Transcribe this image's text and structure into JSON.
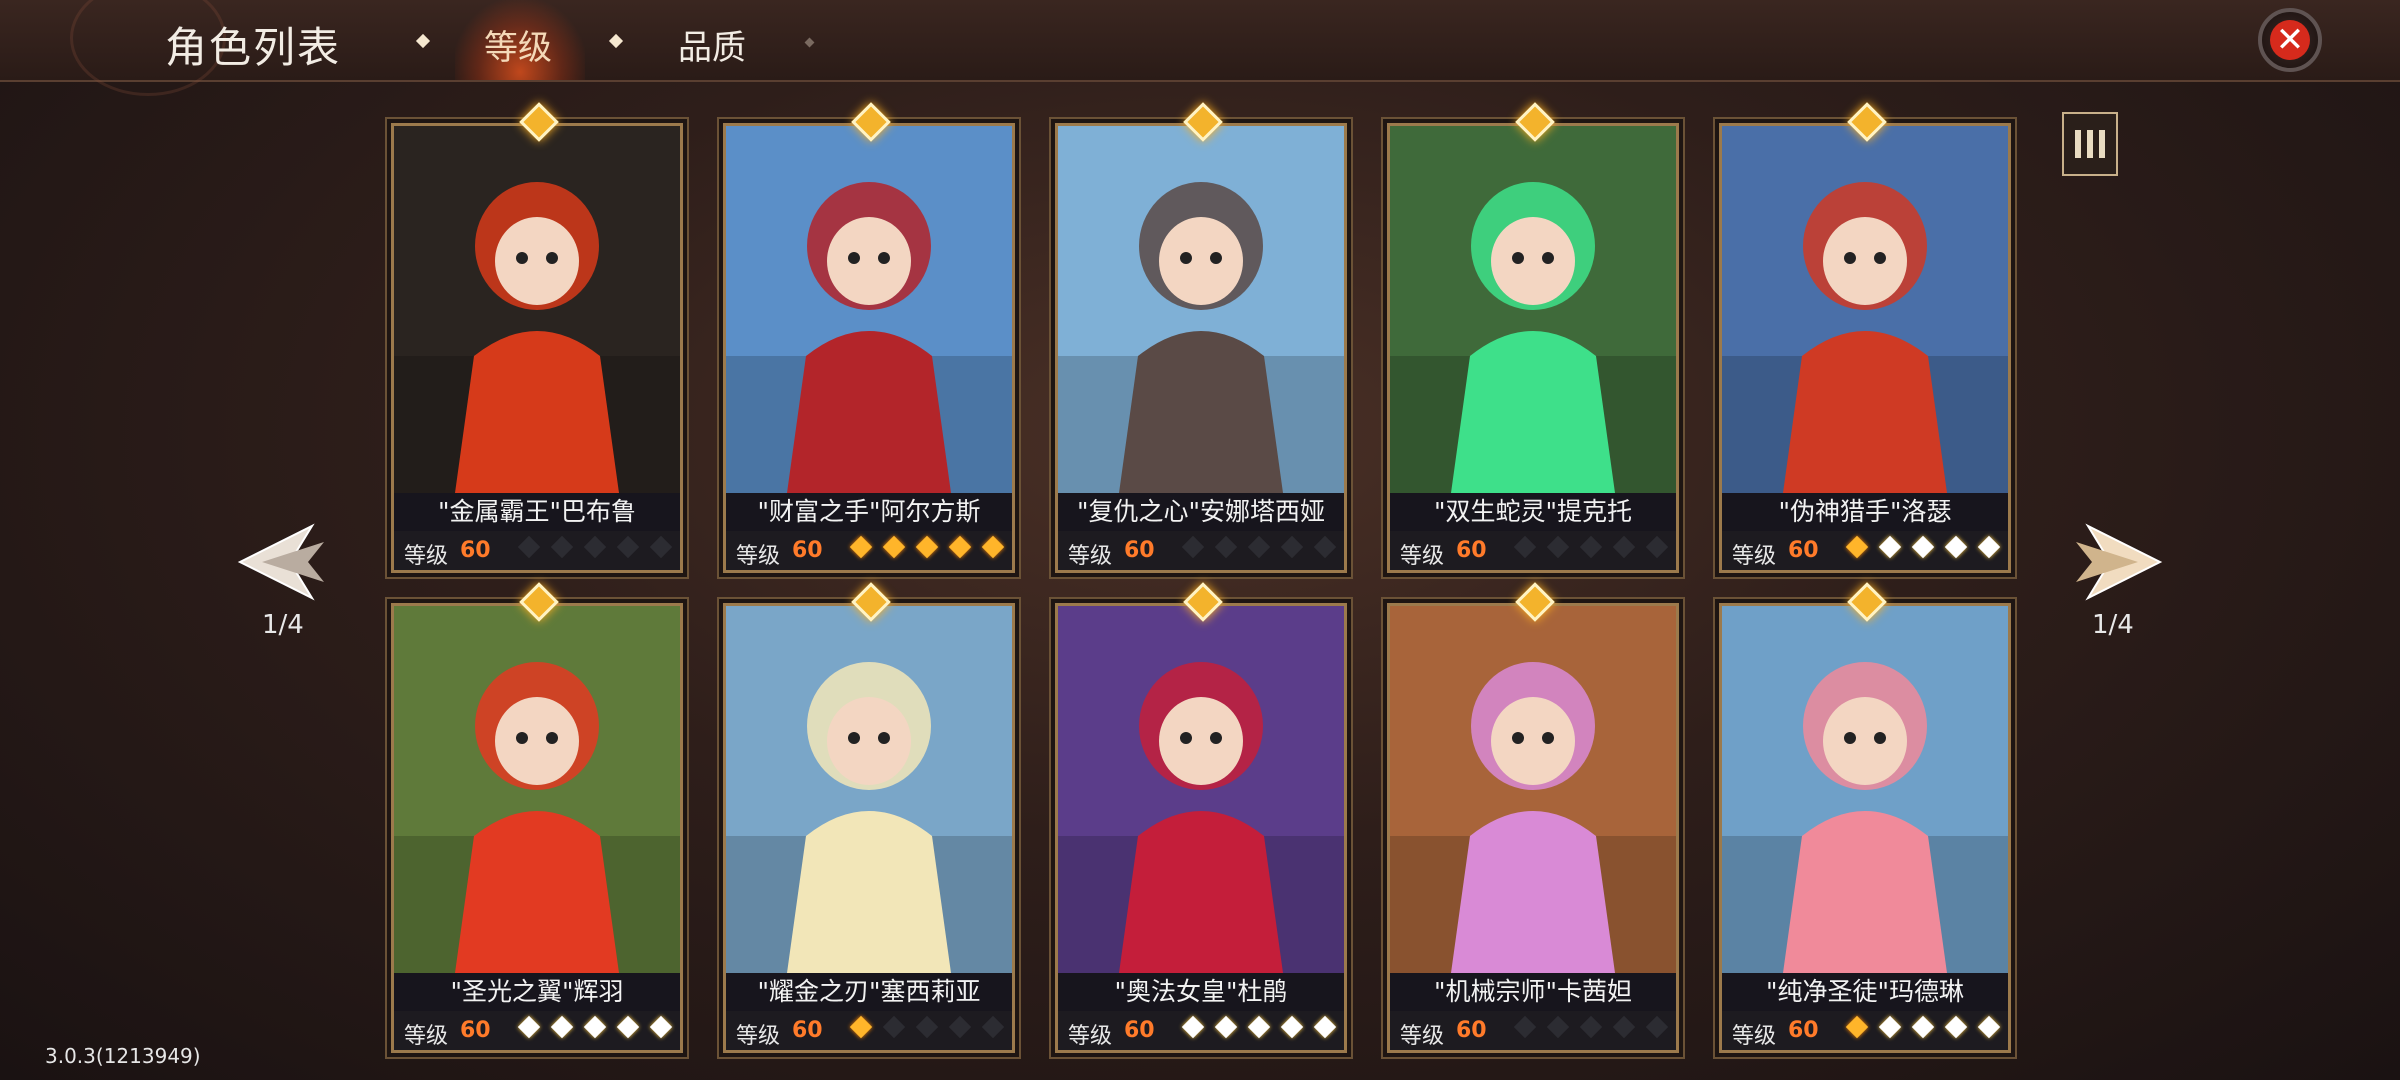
{
  "header": {
    "title": "角色列表",
    "tabs": [
      {
        "label": "等级",
        "active": true
      },
      {
        "label": "品质",
        "active": false
      }
    ]
  },
  "pager": {
    "left": "1/4",
    "right": "1/4"
  },
  "version": "3.0.3(1213949)",
  "level_label": "等级",
  "characters": [
    {
      "name": "\"金属霸王\"巴布鲁",
      "level": "60",
      "stars": [
        0,
        0,
        0,
        0,
        0
      ],
      "bg": "#2a2420",
      "accent": "#d63a1a"
    },
    {
      "name": "\"财富之手\"阿尔方斯",
      "level": "60",
      "stars": [
        2,
        2,
        2,
        2,
        2
      ],
      "bg": "#5b8fc8",
      "accent": "#b3252a"
    },
    {
      "name": "\"复仇之心\"安娜塔西娅",
      "level": "60",
      "stars": [
        0,
        0,
        0,
        0,
        0
      ],
      "bg": "#7fb0d6",
      "accent": "#5a4a46"
    },
    {
      "name": "\"双生蛇灵\"提克托",
      "level": "60",
      "stars": [
        0,
        0,
        0,
        0,
        0
      ],
      "bg": "#3f6a3a",
      "accent": "#3ee08a"
    },
    {
      "name": "\"伪神猎手\"洛瑟",
      "level": "60",
      "stars": [
        2,
        1,
        1,
        1,
        1
      ],
      "bg": "#4a6fa8",
      "accent": "#cf3a24"
    },
    {
      "name": "\"圣光之翼\"辉羽",
      "level": "60",
      "stars": [
        1,
        1,
        1,
        1,
        1
      ],
      "bg": "#5f7a3a",
      "accent": "#e23a22"
    },
    {
      "name": "\"耀金之刃\"塞西莉亚",
      "level": "60",
      "stars": [
        2,
        0,
        0,
        0,
        0
      ],
      "bg": "#7aa6c8",
      "accent": "#f2e6b8"
    },
    {
      "name": "\"奥法女皇\"杜鹃",
      "level": "60",
      "stars": [
        1,
        1,
        1,
        1,
        1
      ],
      "bg": "#5b3d8a",
      "accent": "#c41e3a"
    },
    {
      "name": "\"机械宗师\"卡茜妲",
      "level": "60",
      "stars": [
        0,
        0,
        0,
        0,
        0
      ],
      "bg": "#a8643a",
      "accent": "#d98ad6"
    },
    {
      "name": "\"纯净圣徒\"玛德琳",
      "level": "60",
      "stars": [
        2,
        1,
        1,
        1,
        1
      ],
      "bg": "#6fa0c8",
      "accent": "#f08a9a"
    }
  ],
  "icons": {
    "close": "close-icon",
    "list": "list-view-icon",
    "prev": "prev-arrow-icon",
    "next": "next-arrow-icon"
  }
}
